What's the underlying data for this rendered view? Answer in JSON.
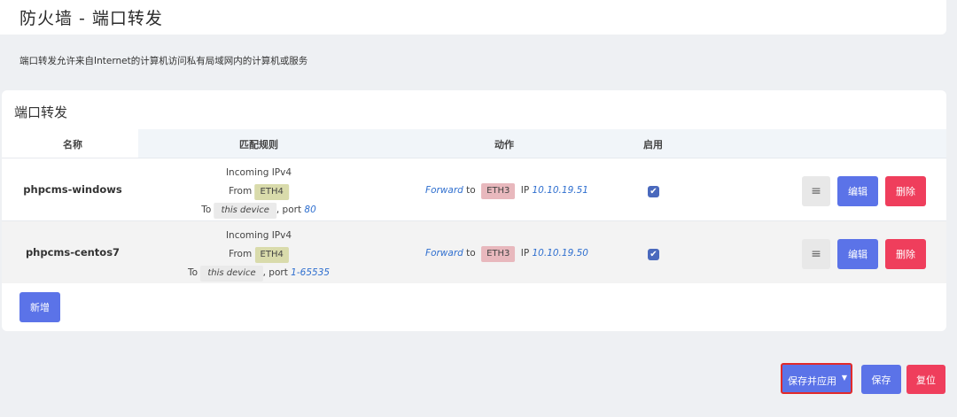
{
  "header": {
    "title": "防火墙 - 端口转发"
  },
  "description": "端口转发允许来自Internet的计算机访问私有局域网内的计算机或服务",
  "section": {
    "title": "端口转发",
    "columns": {
      "name": "名称",
      "match": "匹配规则",
      "action": "动作",
      "enable": "启用"
    },
    "rows": [
      {
        "name": "phpcms-windows",
        "incoming": "Incoming IPv4",
        "from_label": "From",
        "src_zone": "ETH4",
        "to_label": "To",
        "device": "this device",
        "port_label": ", port",
        "port": "80",
        "forward": "Forward",
        "to_word": "to",
        "dest_zone": "ETH3",
        "ip_label": "IP",
        "ip": "10.10.19.51",
        "enabled": true
      },
      {
        "name": "phpcms-centos7",
        "incoming": "Incoming IPv4",
        "from_label": "From",
        "src_zone": "ETH4",
        "to_label": "To",
        "device": "this device",
        "port_label": ", port",
        "port": "1-65535",
        "forward": "Forward",
        "to_word": "to",
        "dest_zone": "ETH3",
        "ip_label": "IP",
        "ip": "10.10.19.50",
        "enabled": true
      }
    ],
    "row_buttons": {
      "menu": "≡",
      "edit": "编辑",
      "delete": "删除"
    },
    "add_button": "新增"
  },
  "footer": {
    "save_apply": "保存并应用",
    "save_apply_caret": "▼",
    "save": "保存",
    "reset": "复位"
  },
  "checkmark": "✔",
  "colors": {
    "primary": "#5b73e8",
    "danger": "#ef3e5c",
    "zone_wan": "#d9dbab",
    "zone_lan": "#e8b8bd",
    "highlight_border": "#e12a2a"
  }
}
